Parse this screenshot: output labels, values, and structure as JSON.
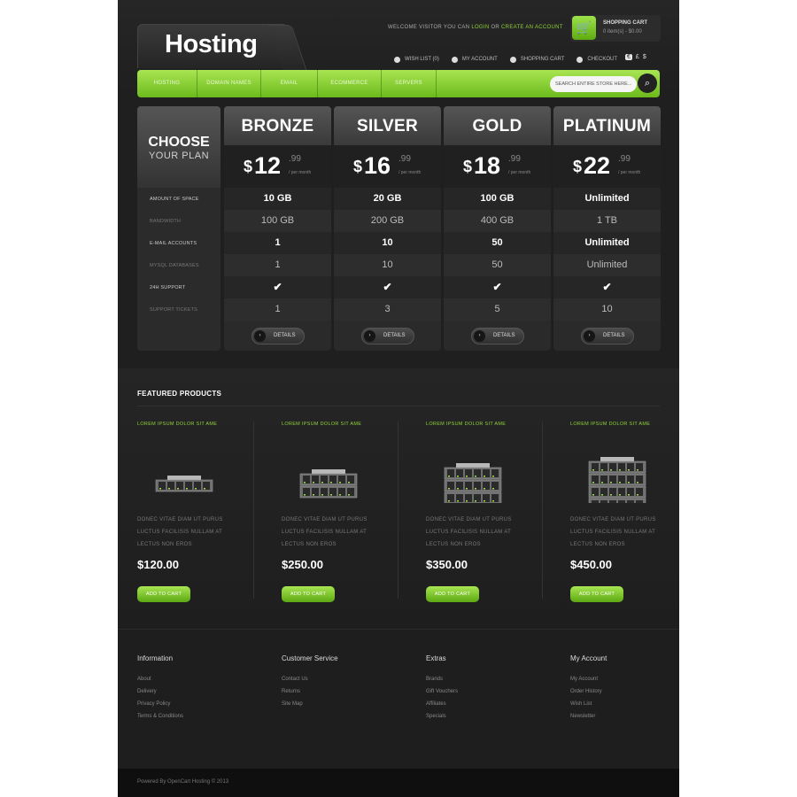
{
  "header": {
    "logo": "Hosting",
    "welcome_prefix": "WELCOME VISITOR YOU CAN",
    "login": "LOGIN",
    "or": "OR",
    "create_account": "CREATE AN ACCOUNT",
    "cart_title": "SHOPPING CART",
    "cart_summary": "0 item(s) - $0.00",
    "top_links": [
      "WISH LIST (0)",
      "MY ACCOUNT",
      "SHOPPING CART",
      "CHECKOUT"
    ],
    "currencies": [
      "€",
      "£",
      "$"
    ]
  },
  "nav": {
    "items": [
      "HOSTING",
      "DOMAIN NAMES",
      "EMAIL",
      "ECOMMERCE",
      "SERVERS"
    ],
    "search_placeholder": "SEARCH ENTIRE STORE HERE..."
  },
  "pricing": {
    "choose_line1": "CHOOSE",
    "choose_line2": "YOUR PLAN",
    "features": [
      "AMOUNT OF SPACE",
      "BANDWIDTH",
      "E-MAIL ACCOUNTS",
      "MYSQL DATABASES",
      "24H SUPPORT",
      "SUPPORT TICKETS"
    ],
    "per_month": "/ per month",
    "currency_symbol": "$",
    "details_label": "DETAILS",
    "plans": [
      {
        "name": "BRONZE",
        "price_int": "12",
        "price_dec": ".99",
        "values": [
          "10 GB",
          "100 GB",
          "1",
          "1",
          "✔",
          "1"
        ]
      },
      {
        "name": "SILVER",
        "price_int": "16",
        "price_dec": ".99",
        "values": [
          "20 GB",
          "200 GB",
          "10",
          "10",
          "✔",
          "3"
        ]
      },
      {
        "name": "GOLD",
        "price_int": "18",
        "price_dec": ".99",
        "values": [
          "100 GB",
          "400 GB",
          "50",
          "50",
          "✔",
          "5"
        ]
      },
      {
        "name": "PLATINUM",
        "price_int": "22",
        "price_dec": ".99",
        "values": [
          "Unlimited",
          "1 TB",
          "Unlimited",
          "Unlimited",
          "✔",
          "10"
        ]
      }
    ]
  },
  "featured": {
    "title": "FEATURED PRODUCTS",
    "add_to_cart": "ADD TO CART",
    "products": [
      {
        "title": "LOREM IPSUM DOLOR SIT AME",
        "desc": "DONEC VITAE DIAM UT PURUS LUCTUS FACILISIS NULLAM AT LECTUS NON EROS",
        "price": "$120.00",
        "units": 1
      },
      {
        "title": "LOREM IPSUM DOLOR SIT AME",
        "desc": "DONEC VITAE DIAM UT PURUS LUCTUS FACILISIS NULLAM AT LECTUS NON EROS",
        "price": "$250.00",
        "units": 2
      },
      {
        "title": "LOREM IPSUM DOLOR SIT AME",
        "desc": "DONEC VITAE DIAM UT PURUS LUCTUS FACILISIS NULLAM AT LECTUS NON EROS",
        "price": "$350.00",
        "units": 3
      },
      {
        "title": "LOREM IPSUM DOLOR SIT AME",
        "desc": "DONEC VITAE DIAM UT PURUS LUCTUS FACILISIS NULLAM AT LECTUS NON EROS",
        "price": "$450.00",
        "units": 4
      }
    ]
  },
  "footer": {
    "columns": [
      {
        "heading": "Information",
        "links": [
          "About",
          "Delivery",
          "Privacy Policy",
          "Terms & Conditions"
        ]
      },
      {
        "heading": "Customer Service",
        "links": [
          "Contact Us",
          "Returns",
          "Site Map"
        ]
      },
      {
        "heading": "Extras",
        "links": [
          "Brands",
          "Gift Vouchers",
          "Affiliates",
          "Specials"
        ]
      },
      {
        "heading": "My Account",
        "links": [
          "My Account",
          "Order History",
          "Wish List",
          "Newsletter"
        ]
      }
    ],
    "powered": "Powered By OpenCart Hosting © 2013"
  },
  "colors": {
    "accent": "#8fd23a",
    "background": "#1c1c1c"
  }
}
